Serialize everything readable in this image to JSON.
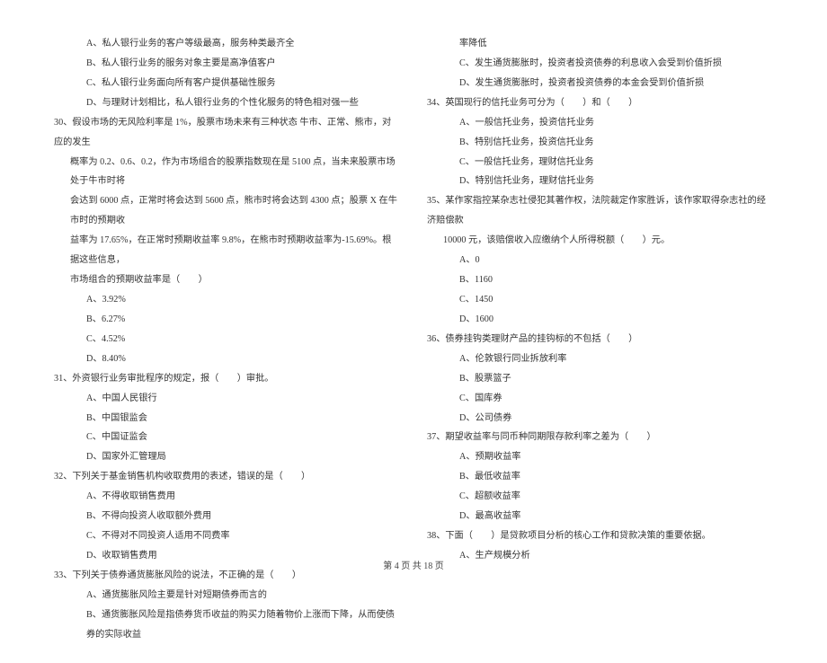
{
  "left": {
    "q29_opts": [
      "A、私人银行业务的客户等级最高，服务种类最齐全",
      "B、私人银行业务的服务对象主要是高净值客户",
      "C、私人银行业务面向所有客户提供基础性服务",
      "D、与理财计划相比，私人银行业务的个性化服务的特色相对强一些"
    ],
    "q30_lines": [
      "30、假设市场的无风险利率是 1%，股票市场未来有三种状态 牛市、正常、熊市，对应的发生",
      "概率为 0.2、0.6、0.2，作为市场组合的股票指数现在是 5100 点，当未来股票市场处于牛市时将",
      "会达到 6000 点，正常时将会达到 5600 点，熊市时将会达到 4300 点；股票 X 在牛市时的预期收",
      "益率为 17.65%，在正常时预期收益率 9.8%，在熊市时预期收益率为-15.69%。根据这些信息，",
      "市场组合的预期收益率是（　　）"
    ],
    "q30_opts": [
      "A、3.92%",
      "B、6.27%",
      "C、4.52%",
      "D、8.40%"
    ],
    "q31": "31、外资银行业务审批程序的规定，报（　　）审批。",
    "q31_opts": [
      "A、中国人民银行",
      "B、中国银监会",
      "C、中国证监会",
      "D、国家外汇管理局"
    ],
    "q32": "32、下列关于基金销售机构收取费用的表述，错误的是（　　）",
    "q32_opts": [
      "A、不得收取销售费用",
      "B、不得向投资人收取额外费用",
      "C、不得对不同投资人适用不同费率",
      "D、收取销售费用"
    ],
    "q33": "33、下列关于债券通货膨胀风险的说法，不正确的是（　　）",
    "q33_opts": [
      "A、通货膨胀风险主要是针对短期债券而言的",
      "B、通货膨胀风险是指债券货币收益的购买力随着物价上涨而下降，从而使债券的实际收益"
    ]
  },
  "right": {
    "q33_cont": "率降低",
    "q33_opts": [
      "C、发生通货膨胀时，投资者投资债券的利息收入会受到价值折损",
      "D、发生通货膨胀时，投资者投资债券的本金会受到价值折损"
    ],
    "q34": "34、英国现行的信托业务可分为（　　）和（　　）",
    "q34_opts": [
      "A、一般信托业务，投资信托业务",
      "B、特别信托业务，投资信托业务",
      "C、一般信托业务，理财信托业务",
      "D、特别信托业务，理财信托业务"
    ],
    "q35_lines": [
      "35、某作家指控某杂志社侵犯其著作权，法院裁定作家胜诉，该作家取得杂志社的经济赔偿款",
      "10000 元，该赔偿收入应缴纳个人所得税额（　　）元。"
    ],
    "q35_opts": [
      "A、0",
      "B、1160",
      "C、1450",
      "D、1600"
    ],
    "q36": "36、债券挂钩类理财产品的挂钩标的不包括（　　）",
    "q36_opts": [
      "A、伦敦银行同业拆放利率",
      "B、股票篮子",
      "C、国库券",
      "D、公司债券"
    ],
    "q37": "37、期望收益率与同币种同期限存款利率之差为（　　）",
    "q37_opts": [
      "A、预期收益率",
      "B、最低收益率",
      "C、超额收益率",
      "D、最高收益率"
    ],
    "q38": "38、下面（　　）是贷款项目分析的核心工作和贷款决策的重要依据。",
    "q38_opts": [
      "A、生产规模分析"
    ]
  },
  "footer": "第 4 页 共 18 页"
}
